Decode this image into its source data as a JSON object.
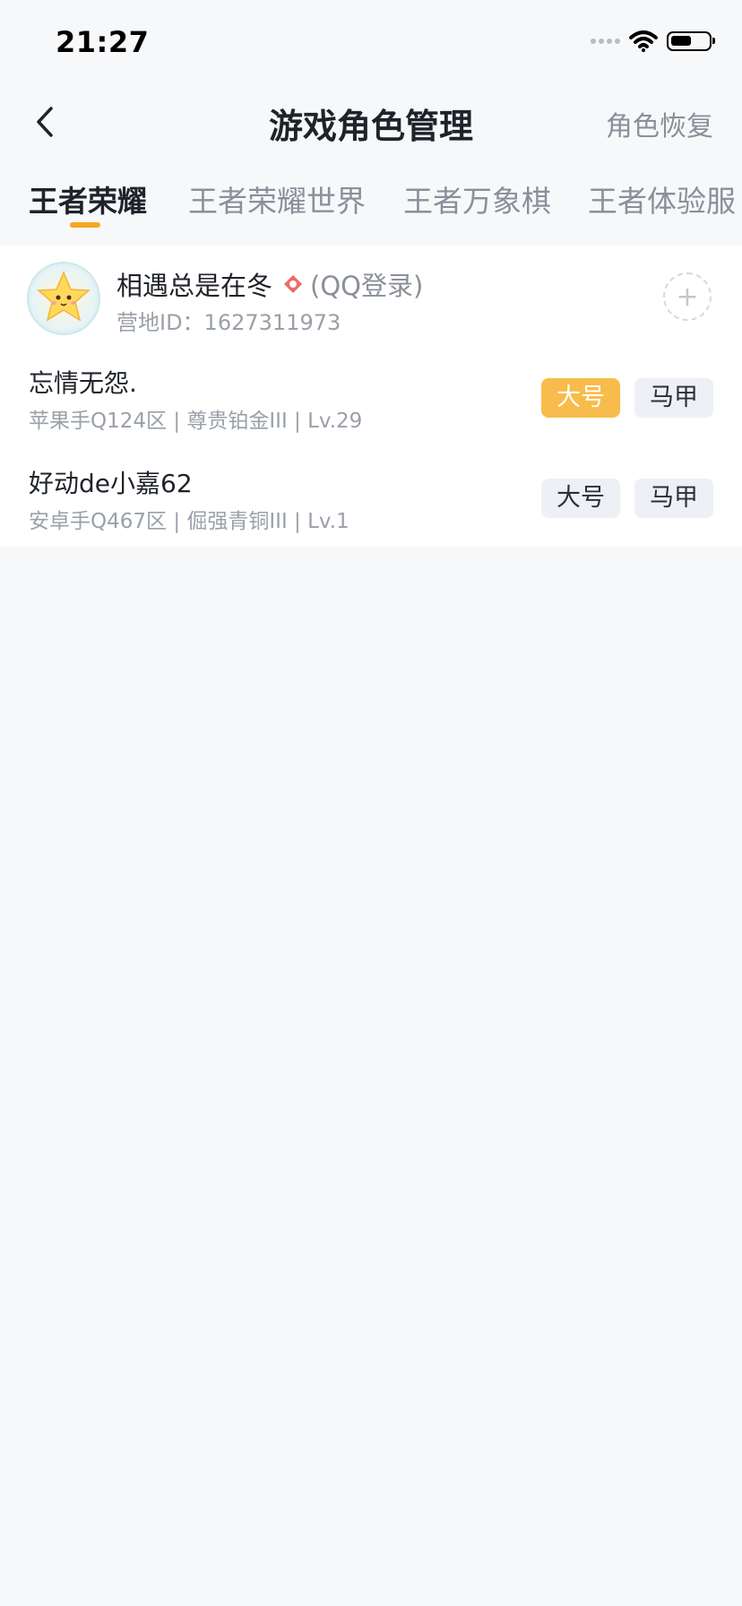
{
  "status_bar": {
    "time": "21:27",
    "icons": [
      "cellular-dots-icon",
      "wifi-icon",
      "battery-icon"
    ]
  },
  "nav": {
    "title": "游戏角色管理",
    "action": "角色恢复",
    "back_icon": "back-chevron-icon"
  },
  "tabs": [
    {
      "label": "王者荣耀",
      "active": true
    },
    {
      "label": "王者荣耀世界",
      "active": false
    },
    {
      "label": "王者万象棋",
      "active": false
    },
    {
      "label": "王者体验服",
      "active": false
    }
  ],
  "account": {
    "name": "相遇总是在冬",
    "login_type": "(QQ登录)",
    "camp_id": "营地ID：1627311973",
    "avatar_icon": "star-avatar",
    "login_icon": "qq-badge-icon",
    "add_icon": "plus-icon"
  },
  "roles": [
    {
      "name": "忘情无怨.",
      "detail": "苹果手Q124区 | 尊贵铂金III | Lv.29",
      "main_label": "大号",
      "alt_label": "马甲",
      "main_selected": true
    },
    {
      "name": "好动de小嘉62",
      "detail": "安卓手Q467区 | 倔强青铜III | Lv.1",
      "main_label": "大号",
      "alt_label": "马甲",
      "main_selected": false
    }
  ],
  "colors": {
    "accent": "#f5a623",
    "selected_pill": "#f8bc4c",
    "pill_gray": "#edf0f4",
    "page_bg": "#f7f8fa"
  }
}
